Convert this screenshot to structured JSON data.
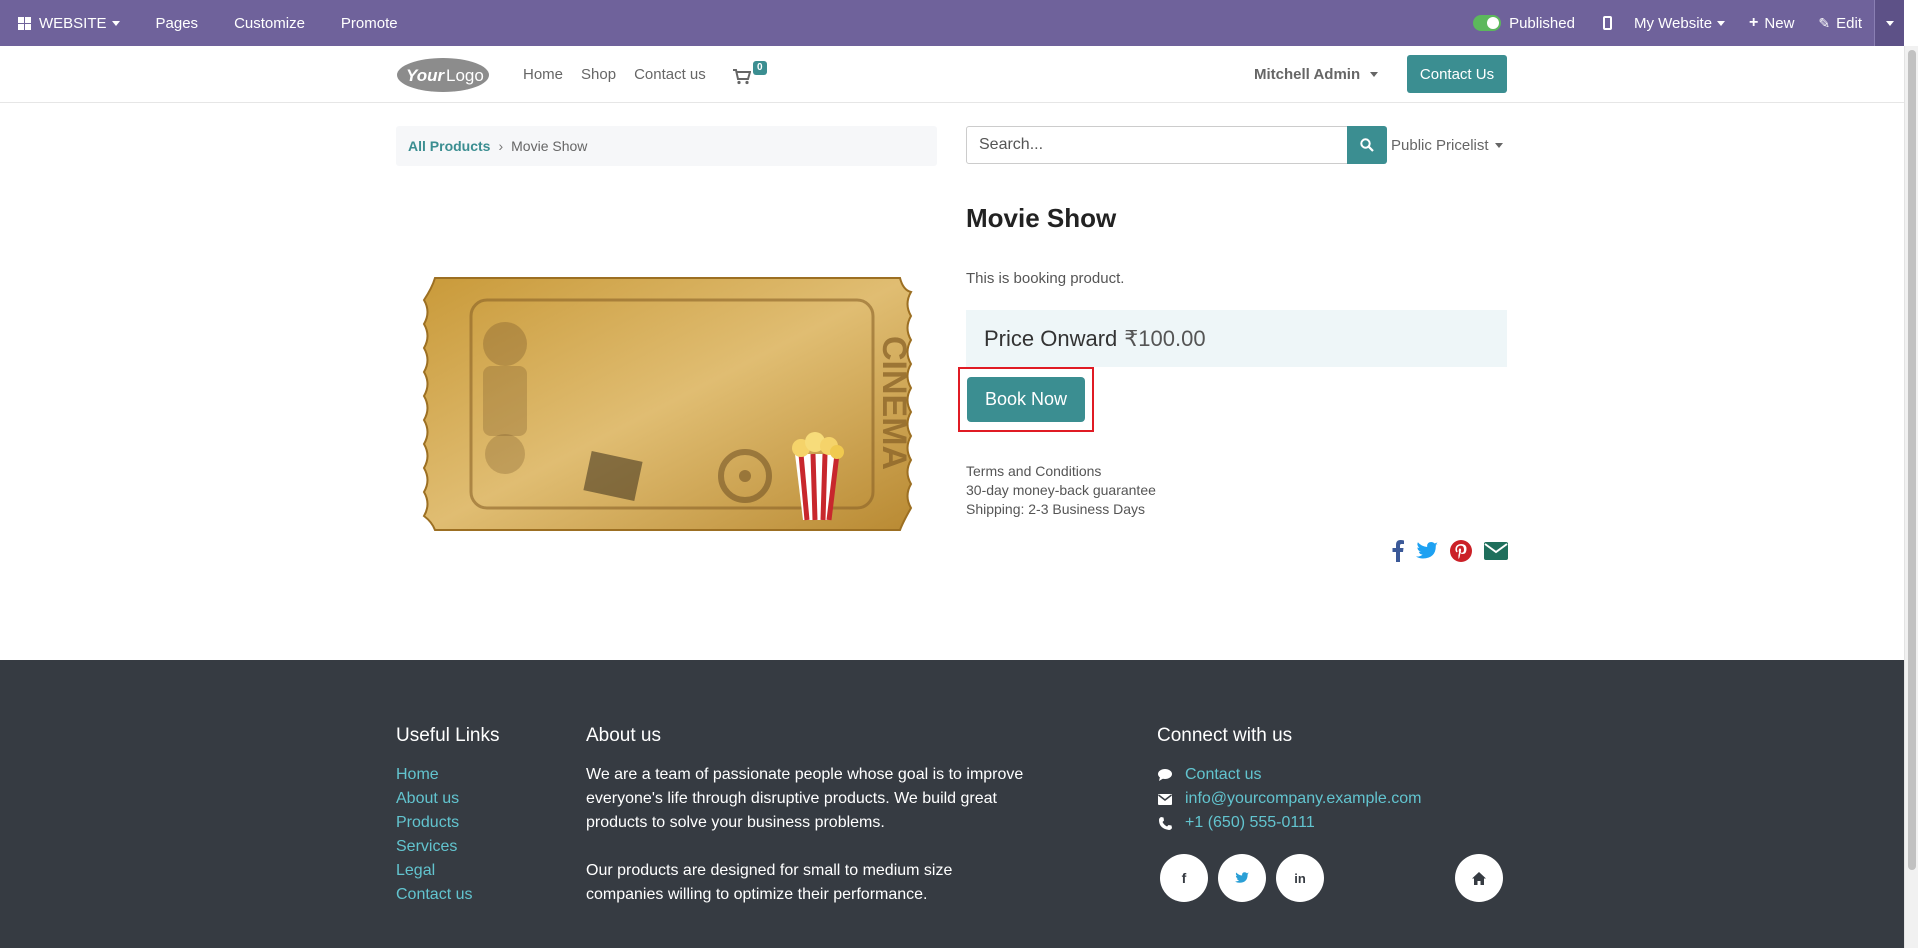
{
  "admin_bar": {
    "website_menu": "WEBSITE",
    "pages": "Pages",
    "customize": "Customize",
    "promote": "Promote",
    "published": "Published",
    "my_website": "My Website",
    "new": "New",
    "edit": "Edit"
  },
  "header": {
    "nav": [
      "Home",
      "Shop",
      "Contact us"
    ],
    "cart_count": "0",
    "user": "Mitchell Admin",
    "contact_button": "Contact Us"
  },
  "breadcrumb": {
    "parent": "All Products",
    "current": "Movie Show"
  },
  "search": {
    "placeholder": "Search...",
    "pricelist": "Public Pricelist"
  },
  "product": {
    "title": "Movie Show",
    "description": "This is booking product.",
    "price_label": "Price Onward",
    "price_amount": "₹100.00",
    "book_button": "Book Now",
    "terms": [
      "Terms and Conditions",
      "30-day money-back guarantee",
      "Shipping: 2-3 Business Days"
    ],
    "image_text": "CINEMA"
  },
  "footer": {
    "useful_links_title": "Useful Links",
    "useful_links": [
      "Home",
      "About us",
      "Products",
      "Services",
      "Legal",
      "Contact us"
    ],
    "about_title": "About us",
    "about_p1": "We are a team of passionate people whose goal is to improve everyone's life through disruptive products. We build great products to solve your business problems.",
    "about_p2": "Our products are designed for small to medium size companies willing to optimize their performance.",
    "connect_title": "Connect with us",
    "connect_contact": "Contact us",
    "connect_email": "info@yourcompany.example.com",
    "connect_phone": "+1 (650) 555-0111"
  },
  "colors": {
    "admin_bar": "#6f629b",
    "accent": "#3b8e91",
    "footer_bg": "#363b42",
    "footer_link": "#62c4cf",
    "highlight": "#e01b24"
  }
}
